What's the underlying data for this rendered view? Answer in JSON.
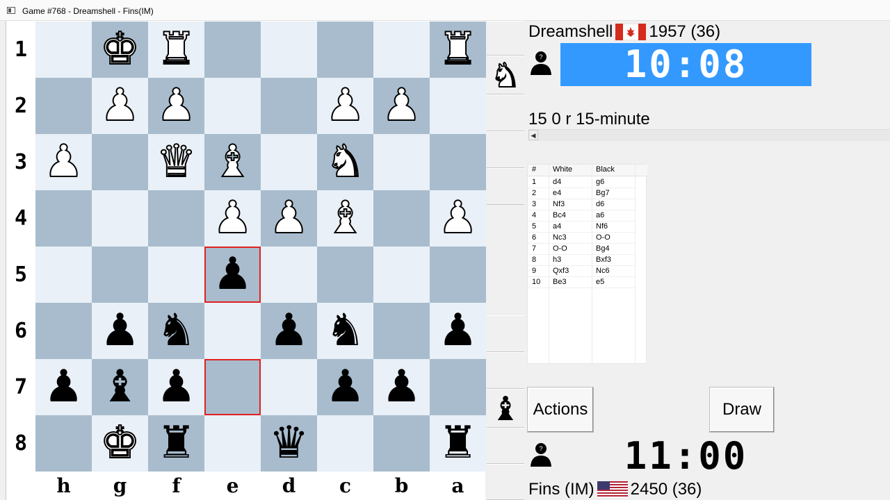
{
  "window": {
    "title": "Game #768 - Dreamshell - Fins(IM)"
  },
  "board": {
    "ranks": [
      "1",
      "2",
      "3",
      "4",
      "5",
      "6",
      "7",
      "8"
    ],
    "files": [
      "h",
      "g",
      "f",
      "e",
      "d",
      "c",
      "b",
      "a"
    ],
    "pieces": [
      {
        "sq": "g1",
        "glyph": "♚",
        "color": "w",
        "name": "white-king"
      },
      {
        "sq": "f1",
        "glyph": "♜",
        "color": "w",
        "name": "white-rook"
      },
      {
        "sq": "a1",
        "glyph": "♜",
        "color": "w",
        "name": "white-rook"
      },
      {
        "sq": "g2",
        "glyph": "♟",
        "color": "w",
        "name": "white-pawn"
      },
      {
        "sq": "f2",
        "glyph": "♟",
        "color": "w",
        "name": "white-pawn"
      },
      {
        "sq": "c2",
        "glyph": "♟",
        "color": "w",
        "name": "white-pawn"
      },
      {
        "sq": "b2",
        "glyph": "♟",
        "color": "w",
        "name": "white-pawn"
      },
      {
        "sq": "h3",
        "glyph": "♟",
        "color": "w",
        "name": "white-pawn"
      },
      {
        "sq": "f3",
        "glyph": "♛",
        "color": "w",
        "name": "white-queen"
      },
      {
        "sq": "e3",
        "glyph": "♝",
        "color": "w",
        "name": "white-bishop"
      },
      {
        "sq": "c3",
        "glyph": "♞",
        "color": "w",
        "name": "white-knight"
      },
      {
        "sq": "e4",
        "glyph": "♟",
        "color": "w",
        "name": "white-pawn"
      },
      {
        "sq": "d4",
        "glyph": "♟",
        "color": "w",
        "name": "white-pawn"
      },
      {
        "sq": "c4",
        "glyph": "♝",
        "color": "w",
        "name": "white-bishop"
      },
      {
        "sq": "a4",
        "glyph": "♟",
        "color": "w",
        "name": "white-pawn"
      },
      {
        "sq": "e5",
        "glyph": "♟",
        "color": "b",
        "name": "black-pawn"
      },
      {
        "sq": "g6",
        "glyph": "♟",
        "color": "b",
        "name": "black-pawn"
      },
      {
        "sq": "f6",
        "glyph": "♞",
        "color": "b",
        "name": "black-knight"
      },
      {
        "sq": "d6",
        "glyph": "♟",
        "color": "b",
        "name": "black-pawn"
      },
      {
        "sq": "c6",
        "glyph": "♞",
        "color": "b",
        "name": "black-knight"
      },
      {
        "sq": "a6",
        "glyph": "♟",
        "color": "b",
        "name": "black-pawn"
      },
      {
        "sq": "h7",
        "glyph": "♟",
        "color": "b",
        "name": "black-pawn"
      },
      {
        "sq": "g7",
        "glyph": "♝",
        "color": "b",
        "name": "black-bishop"
      },
      {
        "sq": "f7",
        "glyph": "♟",
        "color": "b",
        "name": "black-pawn"
      },
      {
        "sq": "c7",
        "glyph": "♟",
        "color": "b",
        "name": "black-pawn"
      },
      {
        "sq": "b7",
        "glyph": "♟",
        "color": "b",
        "name": "black-pawn"
      },
      {
        "sq": "g8",
        "glyph": "♚",
        "color": "w",
        "name": "black-king"
      },
      {
        "sq": "f8",
        "glyph": "♜",
        "color": "b",
        "name": "black-rook"
      },
      {
        "sq": "d8",
        "glyph": "♛",
        "color": "b",
        "name": "black-queen"
      },
      {
        "sq": "a8",
        "glyph": "♜",
        "color": "b",
        "name": "black-rook"
      }
    ],
    "last_move": [
      "e7",
      "e5"
    ],
    "colors": {
      "light": "#e9f0f7",
      "dark": "#a8bccd",
      "highlight": "#e02020"
    }
  },
  "captured": {
    "top": [
      {
        "glyph": "♞",
        "color": "w",
        "name": "captured-white-knight-icon"
      }
    ],
    "bottom": [
      {
        "glyph": "♝",
        "color": "b",
        "name": "captured-black-bishop-icon"
      }
    ]
  },
  "top_player": {
    "name": "Dreamshell",
    "flag": "canada-flag-icon",
    "rating": "1957 (36)",
    "clock": "10:08",
    "clock_color": "#3399ff"
  },
  "bottom_player": {
    "name": "Fins (IM)",
    "flag": "usa-flag-icon",
    "rating": "2450 (36)",
    "clock": "11:00"
  },
  "game_type": "15 0 r 15-minute",
  "moves": {
    "headers": [
      "#",
      "White",
      "Black"
    ],
    "rows": [
      [
        "1",
        "d4",
        "g6"
      ],
      [
        "2",
        "e4",
        "Bg7"
      ],
      [
        "3",
        "Nf3",
        "d6"
      ],
      [
        "4",
        "Bc4",
        "a6"
      ],
      [
        "5",
        "a4",
        "Nf6"
      ],
      [
        "6",
        "Nc3",
        "O-O"
      ],
      [
        "7",
        "O-O",
        "Bg4"
      ],
      [
        "8",
        "h3",
        "Bxf3"
      ],
      [
        "9",
        "Qxf3",
        "Nc6"
      ],
      [
        "10",
        "Be3",
        "e5"
      ]
    ]
  },
  "buttons": {
    "actions": "Actions",
    "draw": "Draw"
  }
}
